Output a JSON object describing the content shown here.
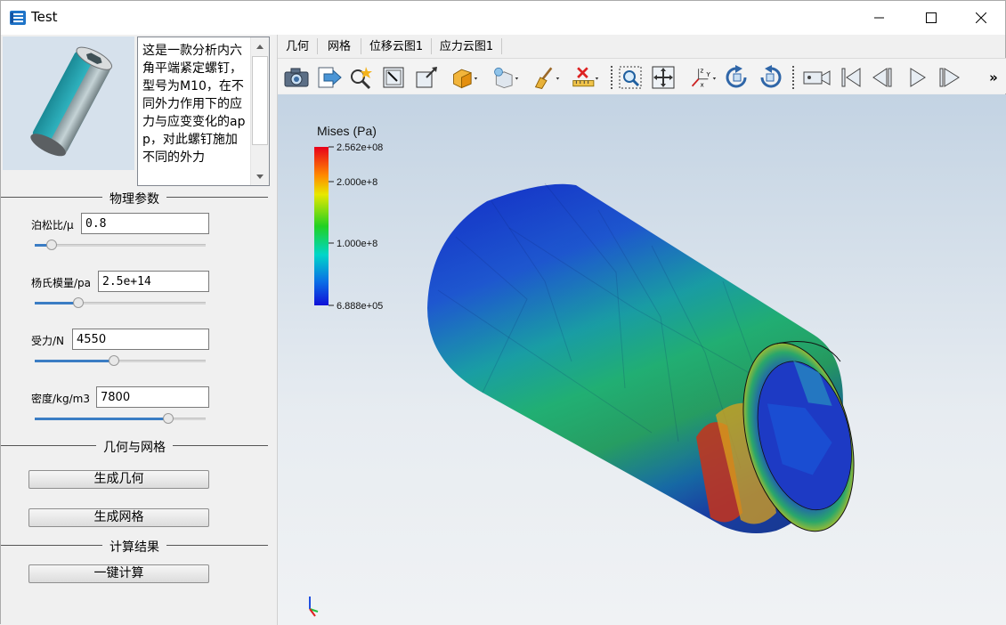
{
  "window": {
    "title": "Test",
    "minimize_label": "minimize",
    "maximize_label": "maximize",
    "close_label": "close"
  },
  "description": {
    "text": "这是一款分析内六角平端紧定螺钉，型号为M10，在不同外力作用下的应力与应变变化的app，对此螺钉施加不同的外力"
  },
  "physics": {
    "title": "物理参数",
    "poisson": {
      "label": "泊松比/μ",
      "value": "0.8",
      "slider_fraction": 0.07
    },
    "young": {
      "label": "杨氏模量/pa",
      "value": "2.5e+14",
      "slider_fraction": 0.24
    },
    "force": {
      "label": "受力/N",
      "value": "4550",
      "slider_fraction": 0.46
    },
    "density": {
      "label": "密度/kg/m3",
      "value": "7800",
      "slider_fraction": 0.8
    }
  },
  "geometry": {
    "title": "几何与网格",
    "gen_geometry": "生成几何",
    "gen_mesh": "生成网格"
  },
  "results": {
    "title": "计算结果",
    "compute": "一键计算"
  },
  "tabs": [
    "几何",
    "网格",
    "位移云图1",
    "应力云图1"
  ],
  "toolbar": {
    "icons": [
      "camera-icon",
      "export-icon",
      "wand-icon",
      "select-icon",
      "box-icon",
      "cube-color-icon",
      "light-icon",
      "broom-icon",
      "ruler-icon",
      "zoom-box-icon",
      "fit-icon",
      "axes-icon",
      "rotate-cw-icon",
      "rotate-ccw-icon",
      "record-icon",
      "first-frame-icon",
      "prev-frame-icon",
      "play-icon",
      "next-frame-icon"
    ],
    "overflow": "»"
  },
  "legend": {
    "title": "Mises (Pa)",
    "max": "2.562e+08",
    "tick2": "2.000e+8",
    "tick1": "1.000e+8",
    "min": "6.888e+05"
  }
}
